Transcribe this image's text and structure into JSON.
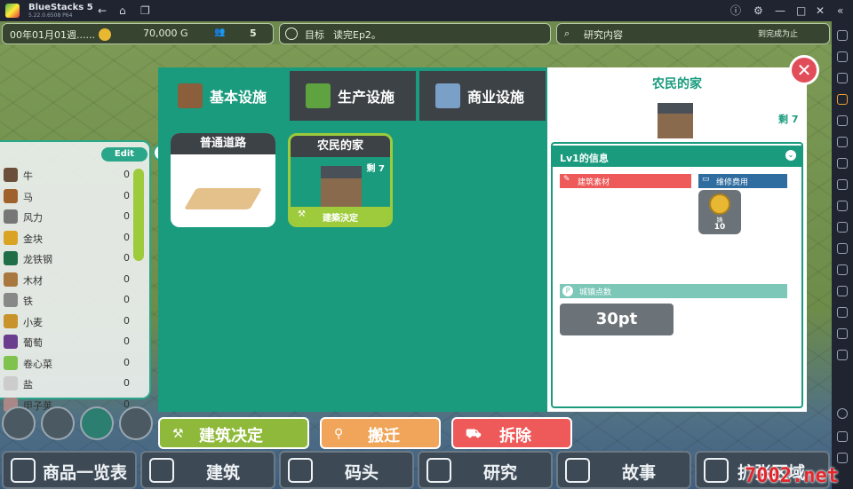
{
  "titlebar": {
    "app_name": "BlueStacks 5",
    "version": "5.22.0.6508 P64"
  },
  "hud": {
    "date": "00年01月01週......",
    "gold": "70,000 G",
    "population": "5",
    "goal_label": "目标",
    "goal_text": "读完Ep2。",
    "research_label": "研究内容",
    "research_status": "到完成为止"
  },
  "dialog": {
    "tabs": [
      {
        "label": "基本设施"
      },
      {
        "label": "生产设施"
      },
      {
        "label": "商业设施"
      }
    ],
    "cards": [
      {
        "name": "普通道路"
      },
      {
        "name": "农民的家",
        "remaining": "剩 7",
        "footer": "建築決定"
      }
    ],
    "detail": {
      "title": "农民的家",
      "remaining": "剩 7",
      "info_header": "Lv1的信息",
      "materials_label": "建筑素材",
      "upkeep_label": "维修费用",
      "upkeep_coin_label": "铸",
      "upkeep_value": "10",
      "town_points_label": "城镇点数",
      "town_points_value": "30pt"
    },
    "close_icon": "close-icon"
  },
  "resources": {
    "edit_label": "Edit",
    "items": [
      {
        "name": "牛",
        "value": "0"
      },
      {
        "name": "马",
        "value": "0"
      },
      {
        "name": "风力",
        "value": "0"
      },
      {
        "name": "金块",
        "value": "0"
      },
      {
        "name": "龙铁钢",
        "value": "0"
      },
      {
        "name": "木材",
        "value": "0"
      },
      {
        "name": "铁",
        "value": "0"
      },
      {
        "name": "小麦",
        "value": "0"
      },
      {
        "name": "葡萄",
        "value": "0"
      },
      {
        "name": "卷心菜",
        "value": "0"
      },
      {
        "name": "盐",
        "value": "0"
      },
      {
        "name": "甲子荚",
        "value": "0"
      }
    ]
  },
  "actions": {
    "build": "建筑决定",
    "relocate": "搬迁",
    "demolish": "拆除"
  },
  "nav": [
    {
      "label": "商品一览表"
    },
    {
      "label": "建筑"
    },
    {
      "label": "码头"
    },
    {
      "label": "研究"
    },
    {
      "label": "故事"
    },
    {
      "label": "扩张区域"
    }
  ],
  "watermark": "7002.net",
  "colors": {
    "accent": "#1a9b7d",
    "build": "#8fb93a",
    "relocate": "#f0a55a",
    "demolish": "#ee5a5a"
  }
}
